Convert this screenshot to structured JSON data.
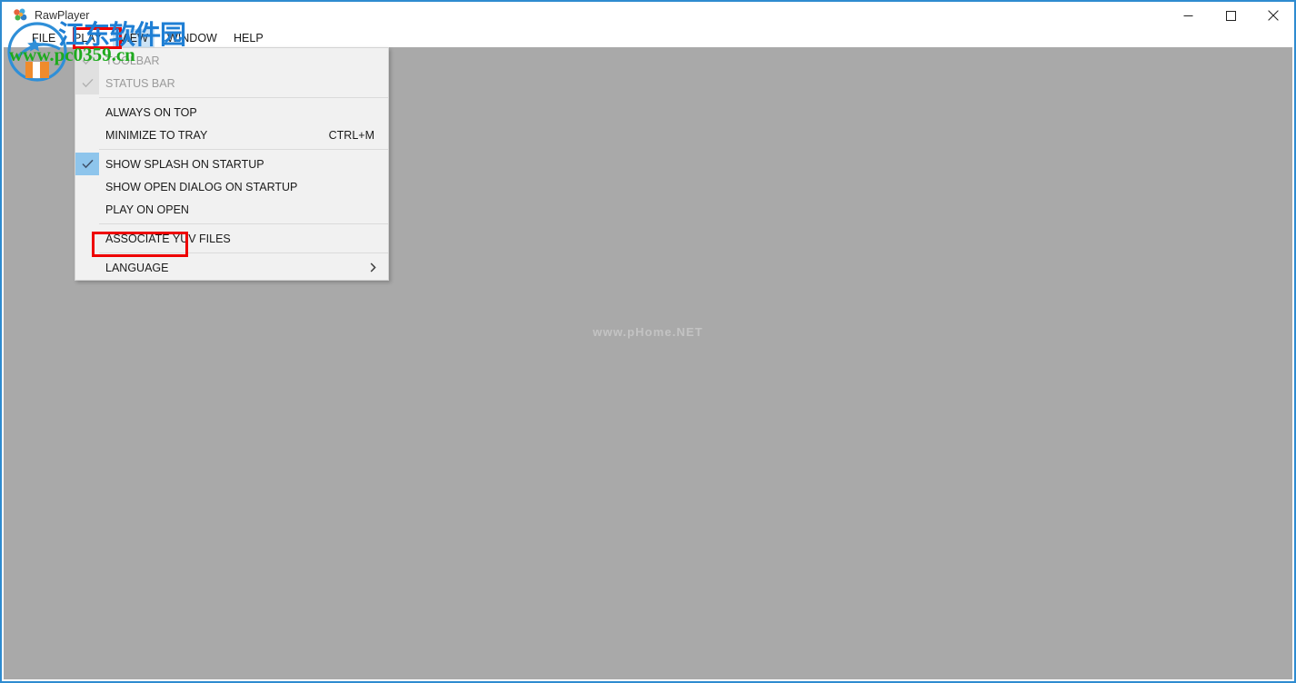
{
  "window": {
    "title": "RawPlayer",
    "app_icon": "rawplayer-logo-icon",
    "border_color": "#2e8bd0",
    "controls": {
      "minimize_label": "Minimize",
      "maximize_label": "Maximize",
      "close_label": "Close"
    }
  },
  "menu_bar": {
    "items": [
      {
        "label": "FILE",
        "open": false
      },
      {
        "label": "PLAY",
        "open": false
      },
      {
        "label": "VIEW",
        "open": true
      },
      {
        "label": "WINDOW",
        "open": false
      },
      {
        "label": "HELP",
        "open": false
      }
    ]
  },
  "view_menu": {
    "items": [
      {
        "label": "TOOLBAR",
        "checked": true,
        "enabled": false,
        "accel": "",
        "submenu": false
      },
      {
        "label": "STATUS BAR",
        "checked": true,
        "enabled": false,
        "accel": "",
        "submenu": false
      },
      {
        "separator": true
      },
      {
        "label": "ALWAYS ON TOP",
        "checked": false,
        "enabled": true,
        "accel": "",
        "submenu": false
      },
      {
        "label": "MINIMIZE TO TRAY",
        "checked": false,
        "enabled": true,
        "accel": "CTRL+M",
        "submenu": false
      },
      {
        "separator": true
      },
      {
        "label": "SHOW SPLASH ON STARTUP",
        "checked": true,
        "enabled": true,
        "accel": "",
        "submenu": false
      },
      {
        "label": "SHOW OPEN DIALOG ON STARTUP",
        "checked": false,
        "enabled": true,
        "accel": "",
        "submenu": false
      },
      {
        "label": "PLAY ON OPEN",
        "checked": false,
        "enabled": true,
        "accel": "",
        "submenu": false
      },
      {
        "separator": true
      },
      {
        "label": "ASSOCIATE YUV FILES",
        "checked": false,
        "enabled": true,
        "accel": "",
        "submenu": false
      },
      {
        "separator": true
      },
      {
        "label": "LANGUAGE",
        "checked": false,
        "enabled": true,
        "accel": "",
        "submenu": true
      }
    ]
  },
  "content": {
    "background_color": "#a9a9a9",
    "watermark_text": "www.pHome.NET"
  },
  "annotations": [
    {
      "name": "view-menu-highlight",
      "color": "#ee0000",
      "target": "VIEW"
    },
    {
      "name": "language-item-highlight",
      "color": "#ee0000",
      "target": "LANGUAGE"
    }
  ],
  "site_watermark": {
    "chinese_text": "江东软件园",
    "url_text": "www.pc0359.cn",
    "chinese_color": "#1f7fd4",
    "url_color": "#1eaa1e"
  }
}
